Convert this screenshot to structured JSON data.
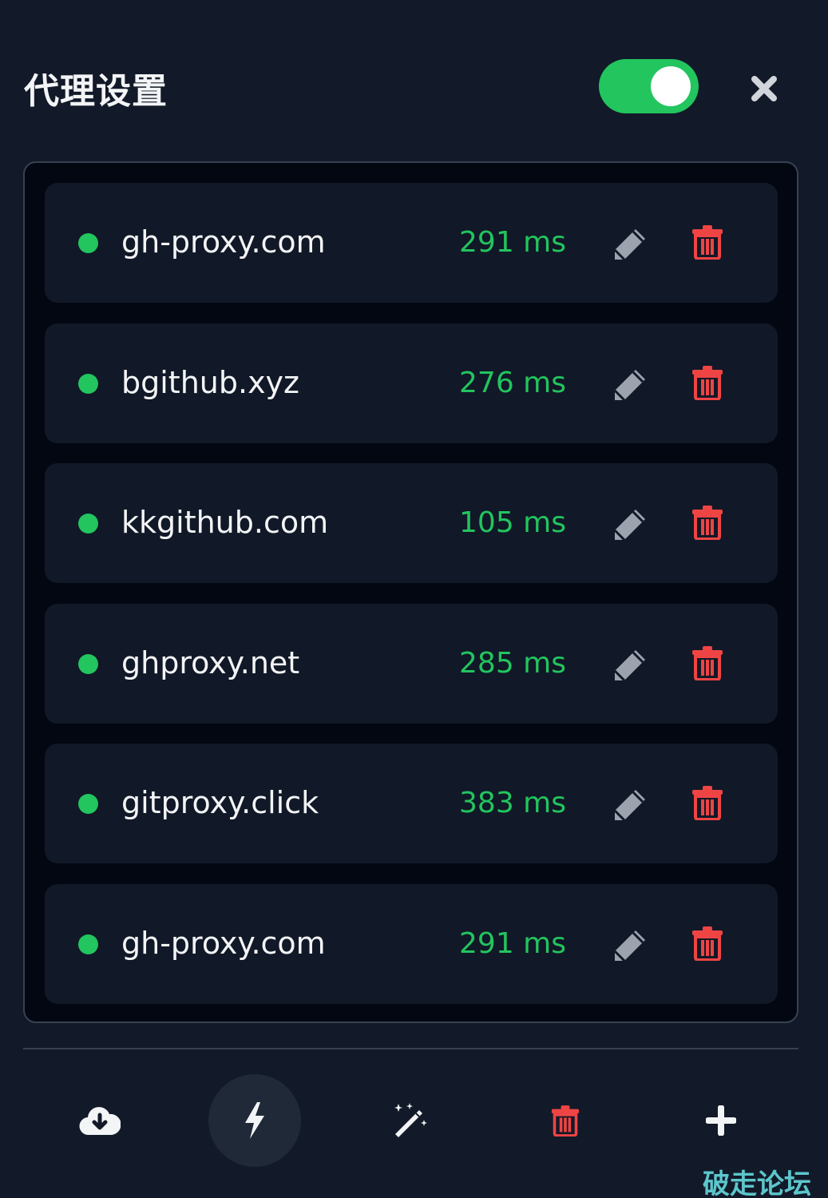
{
  "header": {
    "title": "代理设置",
    "toggle_on": true,
    "close_icon": "close-icon"
  },
  "colors": {
    "background": "#121a29",
    "panel": "#030712",
    "row": "#111827",
    "accent_green": "#22c55e",
    "danger_red": "#ef4444",
    "icon_gray": "#9ca3af"
  },
  "proxies": [
    {
      "host": "gh-proxy.com",
      "latency": "291 ms",
      "status": "online"
    },
    {
      "host": "bgithub.xyz",
      "latency": "276 ms",
      "status": "online"
    },
    {
      "host": "kkgithub.com",
      "latency": "105 ms",
      "status": "online"
    },
    {
      "host": "ghproxy.net",
      "latency": "285 ms",
      "status": "online"
    },
    {
      "host": "gitproxy.click",
      "latency": "383 ms",
      "status": "online"
    },
    {
      "host": "gh-proxy.com",
      "latency": "291 ms",
      "status": "online"
    }
  ],
  "row_icons": {
    "edit": "pencil-icon",
    "delete": "trash-icon"
  },
  "footer": {
    "buttons": [
      {
        "name": "import",
        "icon": "cloud-download-icon"
      },
      {
        "name": "speed-test",
        "icon": "lightning-icon",
        "active": true
      },
      {
        "name": "auto-select",
        "icon": "magic-wand-icon"
      },
      {
        "name": "delete-all",
        "icon": "trash-icon"
      },
      {
        "name": "add",
        "icon": "plus-icon"
      }
    ]
  },
  "watermark": "破走论坛"
}
